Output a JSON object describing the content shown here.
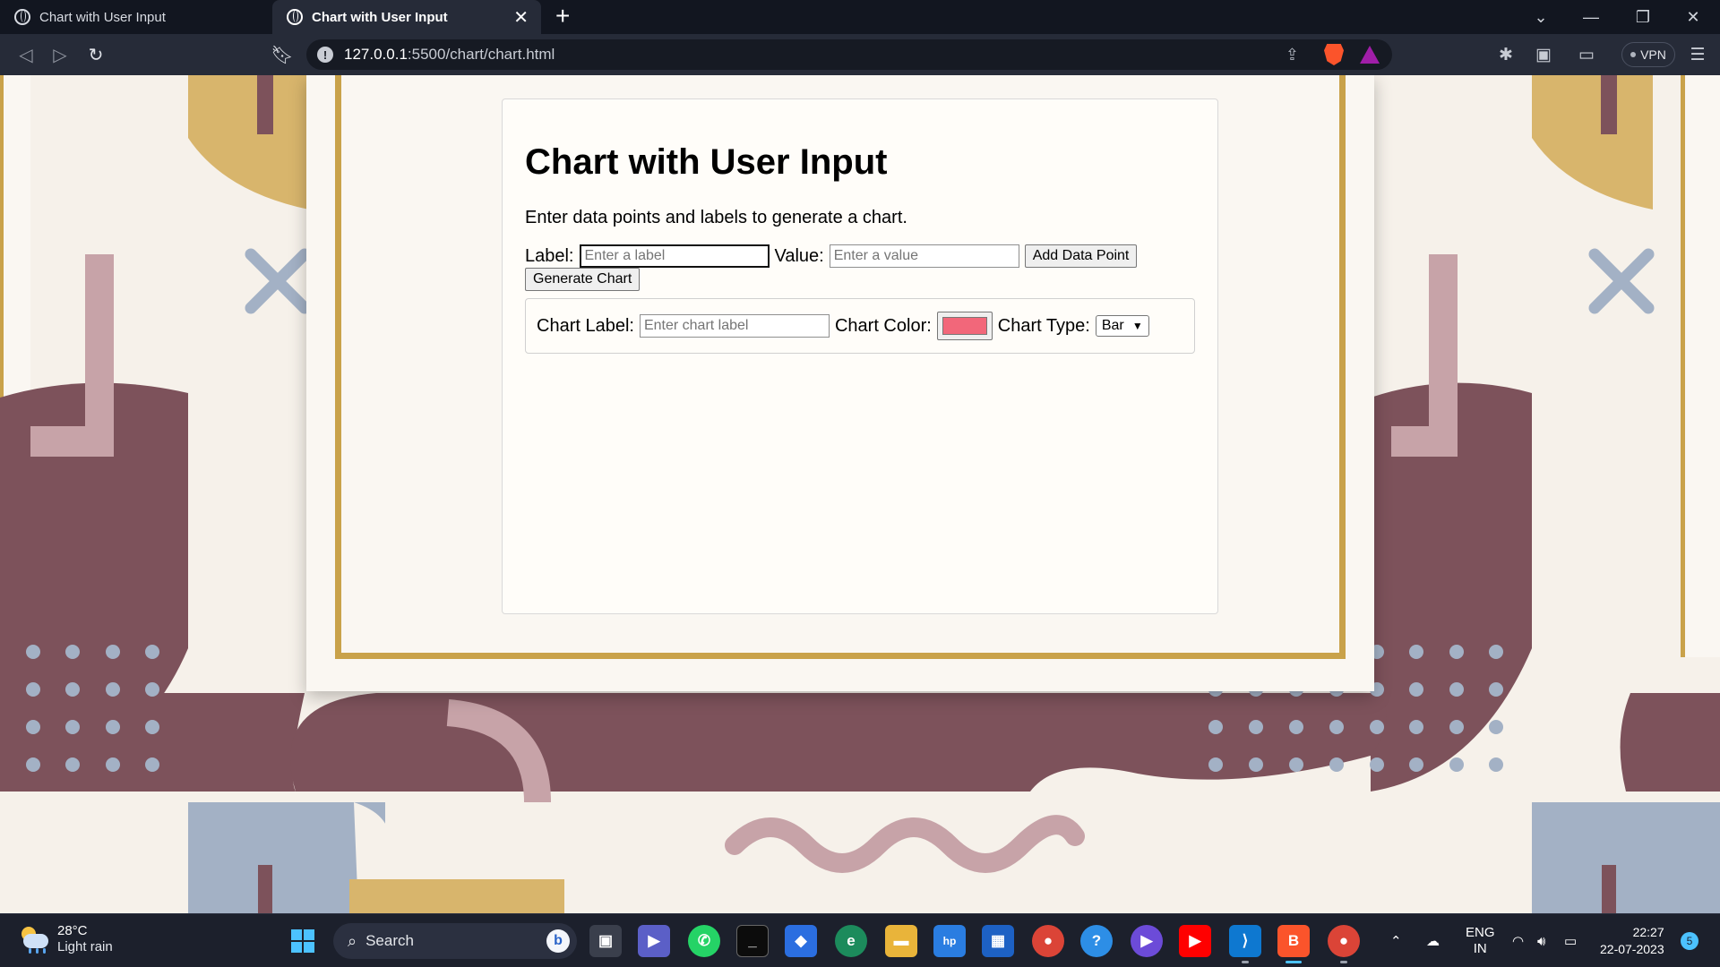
{
  "browser": {
    "tabs": [
      {
        "title": "Chart with User Input",
        "active": false
      },
      {
        "title": "Chart with User Input",
        "active": true
      }
    ],
    "new_tab_label": "+",
    "url_host": "127.0.0.1",
    "url_rest": ":5500/chart/chart.html",
    "vpn_label": "VPN"
  },
  "page": {
    "title": "Chart with User Input",
    "description": "Enter data points and labels to generate a chart.",
    "label_label": "Label:",
    "label_placeholder": "Enter a label",
    "value_label": "Value:",
    "value_placeholder": "Enter a value",
    "add_button": "Add Data Point",
    "generate_button": "Generate Chart",
    "chart_label_label": "Chart Label:",
    "chart_label_placeholder": "Enter chart label",
    "chart_color_label": "Chart Color:",
    "chart_color_value": "#f2677a",
    "chart_type_label": "Chart Type:",
    "chart_type_selected": "Bar"
  },
  "taskbar": {
    "weather_temp": "28°C",
    "weather_desc": "Light rain",
    "search_label": "Search",
    "lang_top": "ENG",
    "lang_bottom": "IN",
    "time": "22:27",
    "date": "22-07-2023",
    "notification_count": "5"
  },
  "colors": {
    "gold": "#c9a24a",
    "maroon": "#7d525b",
    "blush": "#c7a3a8",
    "slate": "#a3b1c5",
    "mustard": "#d8b56c"
  }
}
